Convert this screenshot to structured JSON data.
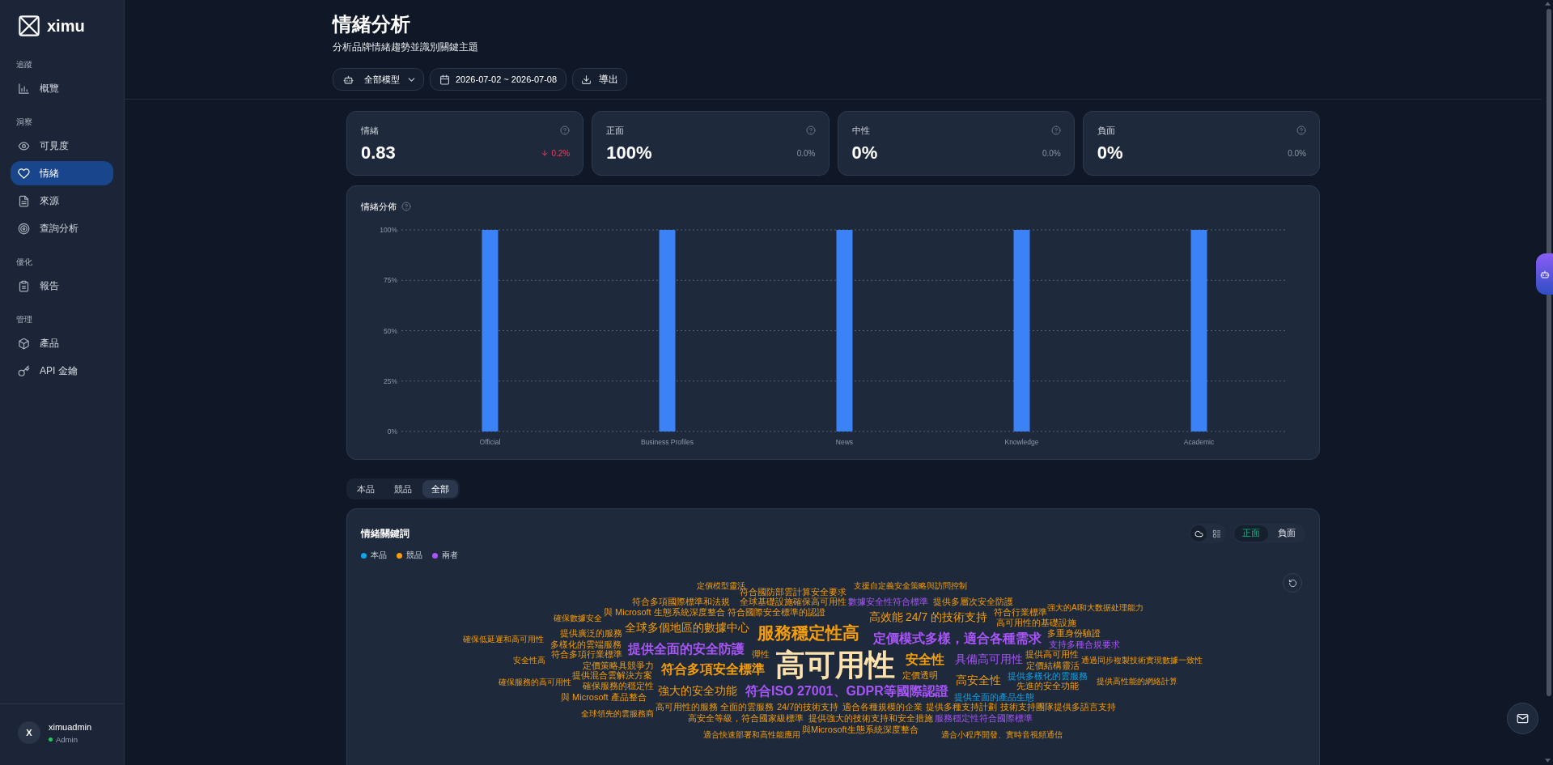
{
  "sidebar": {
    "brand": "ximu",
    "sections": [
      {
        "title": "追蹤",
        "items": [
          {
            "label": "概覽",
            "selected": false
          }
        ]
      },
      {
        "title": "洞察",
        "items": [
          {
            "label": "可見度",
            "selected": false
          },
          {
            "label": "情緒",
            "selected": true
          },
          {
            "label": "來源",
            "selected": false
          },
          {
            "label": "查詢分析",
            "selected": false
          }
        ]
      },
      {
        "title": "優化",
        "items": [
          {
            "label": "報告",
            "selected": false
          }
        ]
      },
      {
        "title": "管理",
        "items": [
          {
            "label": "產品",
            "selected": false
          },
          {
            "label": "API 金鑰",
            "selected": false
          }
        ]
      }
    ],
    "user": {
      "initial": "X",
      "name": "ximuadmin",
      "role": "Admin",
      "online": true
    }
  },
  "header": {
    "title": "情緒分析",
    "subtitle": "分析品牌情緒趨勢並識別關鍵主題",
    "model_select": "全部模型",
    "date_range": "2026-07-02 ~ 2026-07-08",
    "export_button": "導出"
  },
  "kpis": [
    {
      "label": "情緒",
      "value": "0.83",
      "change": "0.2%",
      "falling": true
    },
    {
      "label": "正面",
      "value": "100%",
      "change": "0.0%",
      "falling": false
    },
    {
      "label": "中性",
      "value": "0%",
      "change": "0.0%",
      "falling": false
    },
    {
      "label": "負面",
      "value": "0%",
      "change": "0.0%",
      "falling": false
    }
  ],
  "distribution": {
    "title": "情緒分佈",
    "chart_data": {
      "type": "bar",
      "categories": [
        "Official",
        "Business Profiles",
        "News",
        "Knowledge",
        "Academic"
      ],
      "values": [
        100,
        100,
        100,
        100,
        100
      ],
      "ylim": [
        0,
        100
      ],
      "yticks": [
        {
          "value": 0,
          "label": "0%"
        },
        {
          "value": 25,
          "label": "25%"
        },
        {
          "value": 50,
          "label": "50%"
        },
        {
          "value": 75,
          "label": "75%"
        },
        {
          "value": 100,
          "label": "100%"
        }
      ],
      "grid": true
    }
  },
  "scope_tabs": [
    {
      "label": "本品",
      "selected": false
    },
    {
      "label": "競品",
      "selected": false
    },
    {
      "label": "全部",
      "selected": true
    }
  ],
  "keywords": {
    "title": "情緒關鍵詞",
    "legend": [
      {
        "label": "本品",
        "color": "#0ea5e9"
      },
      {
        "label": "競品",
        "color": "#f59e0b"
      },
      {
        "label": "兩者",
        "color": "#a855f7"
      }
    ],
    "view_toggle": [
      {
        "kind": "cloud",
        "selected": true
      },
      {
        "kind": "list",
        "selected": false
      }
    ],
    "polarity_tabs": [
      {
        "label": "正面",
        "selected": true
      },
      {
        "label": "負面",
        "selected": false
      }
    ],
    "words": [
      {
        "text": "定價模型靈活",
        "kind": "competitor",
        "highlighted": false
      },
      {
        "text": "符合國防部雲計算安全要求",
        "kind": "competitor",
        "highlighted": false
      },
      {
        "text": "支援自定義安全策略與訪問控制",
        "kind": "competitor",
        "highlighted": false
      },
      {
        "text": "符合多項國際標準和法規",
        "kind": "competitor",
        "highlighted": false
      },
      {
        "text": "全球基礎設施確保高可用性",
        "kind": "competitor",
        "highlighted": false
      },
      {
        "text": "數據安全性符合標準",
        "kind": "both",
        "highlighted": false
      },
      {
        "text": "提供多層次安全防護",
        "kind": "competitor",
        "highlighted": false
      },
      {
        "text": "强大的AI和大数据处理能力",
        "kind": "competitor",
        "highlighted": false
      },
      {
        "text": "確保數據安全",
        "kind": "competitor",
        "highlighted": false
      },
      {
        "text": "與 Microsoft 生態系統深度整合",
        "kind": "competitor",
        "highlighted": false
      },
      {
        "text": "符合國際安全標準的認證",
        "kind": "competitor",
        "highlighted": false
      },
      {
        "text": "高效能",
        "kind": "competitor",
        "highlighted": false
      },
      {
        "text": "24/7 的技術支持",
        "kind": "competitor",
        "highlighted": false
      },
      {
        "text": "符合行業標準",
        "kind": "competitor",
        "highlighted": false
      },
      {
        "text": "高可用性的基礎設施",
        "kind": "competitor",
        "highlighted": false
      },
      {
        "text": "確保低延遲和高可用性",
        "kind": "competitor",
        "highlighted": false
      },
      {
        "text": "提供廣泛的服務",
        "kind": "competitor",
        "highlighted": false
      },
      {
        "text": "全球多個地區的數據中心",
        "kind": "competitor",
        "highlighted": false
      },
      {
        "text": "服務穩定性高",
        "kind": "competitor",
        "highlighted": false
      },
      {
        "text": "定價模式多樣，適合各種需求",
        "kind": "both",
        "highlighted": false
      },
      {
        "text": "多重身份驗證",
        "kind": "competitor",
        "highlighted": false
      },
      {
        "text": "多樣化的雲端服務",
        "kind": "competitor",
        "highlighted": false
      },
      {
        "text": "支持多種合規要求",
        "kind": "both",
        "highlighted": false
      },
      {
        "text": "安全性高",
        "kind": "competitor",
        "highlighted": false
      },
      {
        "text": "符合多項行業標準",
        "kind": "competitor",
        "highlighted": false
      },
      {
        "text": "提供全面的安全防護",
        "kind": "both",
        "highlighted": false
      },
      {
        "text": "彈性",
        "kind": "competitor",
        "highlighted": false
      },
      {
        "text": "定價策略具競爭力",
        "kind": "competitor",
        "highlighted": false
      },
      {
        "text": "符合多項安全標準",
        "kind": "competitor",
        "highlighted": false
      },
      {
        "text": "高可用性",
        "kind": "competitor",
        "highlighted": true
      },
      {
        "text": "安全性",
        "kind": "competitor",
        "highlighted": false
      },
      {
        "text": "具備高可用性",
        "kind": "both",
        "highlighted": false
      },
      {
        "text": "提供高可用性",
        "kind": "competitor",
        "highlighted": false
      },
      {
        "text": "定價結構靈活",
        "kind": "competitor",
        "highlighted": false
      },
      {
        "text": "通過同步複製技術實現數據一致性",
        "kind": "competitor",
        "highlighted": false
      },
      {
        "text": "確保服務的高可用性",
        "kind": "competitor",
        "highlighted": false
      },
      {
        "text": "提供混合雲解決方案",
        "kind": "competitor",
        "highlighted": false
      },
      {
        "text": "定價透明",
        "kind": "competitor",
        "highlighted": false
      },
      {
        "text": "確保服務的穩定性",
        "kind": "competitor",
        "highlighted": false
      },
      {
        "text": "與 Microsoft 產品整合",
        "kind": "competitor",
        "highlighted": false
      },
      {
        "text": "強大的安全功能",
        "kind": "competitor",
        "highlighted": false
      },
      {
        "text": "符合ISO 27001、GDPR等國際認證",
        "kind": "both",
        "highlighted": false
      },
      {
        "text": "高安全性",
        "kind": "competitor",
        "highlighted": false
      },
      {
        "text": "提供多樣化的雲服務",
        "kind": "brand",
        "highlighted": false
      },
      {
        "text": "先進的安全功能",
        "kind": "competitor",
        "highlighted": false
      },
      {
        "text": "提供高性能的網絡計算",
        "kind": "competitor",
        "highlighted": false
      },
      {
        "text": "提供全面的產品生態",
        "kind": "brand",
        "highlighted": false
      },
      {
        "text": "全球領先的雲服務商",
        "kind": "competitor",
        "highlighted": false
      },
      {
        "text": "高可用性的服務",
        "kind": "competitor",
        "highlighted": false
      },
      {
        "text": "全面的雲服務",
        "kind": "competitor",
        "highlighted": false
      },
      {
        "text": "24/7的技術支持",
        "kind": "competitor",
        "highlighted": false
      },
      {
        "text": "適合各種規模的企業",
        "kind": "competitor",
        "highlighted": false
      },
      {
        "text": "提供多種支持計劃",
        "kind": "competitor",
        "highlighted": false
      },
      {
        "text": "技術支持團隊提供多語言支持",
        "kind": "competitor",
        "highlighted": false
      },
      {
        "text": "高安全等級，符合國家級標準",
        "kind": "competitor",
        "highlighted": false
      },
      {
        "text": "提供強大的技術支持和安全措施",
        "kind": "competitor",
        "highlighted": false
      },
      {
        "text": "服務穩定性符合國際標準",
        "kind": "both",
        "highlighted": false
      },
      {
        "text": "適合快速部署和高性能應用",
        "kind": "competitor",
        "highlighted": false
      },
      {
        "text": "與Microsoft生態系統深度整合",
        "kind": "competitor",
        "highlighted": false
      },
      {
        "text": "適合小程序開發、實時音視頻通信",
        "kind": "competitor",
        "highlighted": false
      }
    ]
  }
}
